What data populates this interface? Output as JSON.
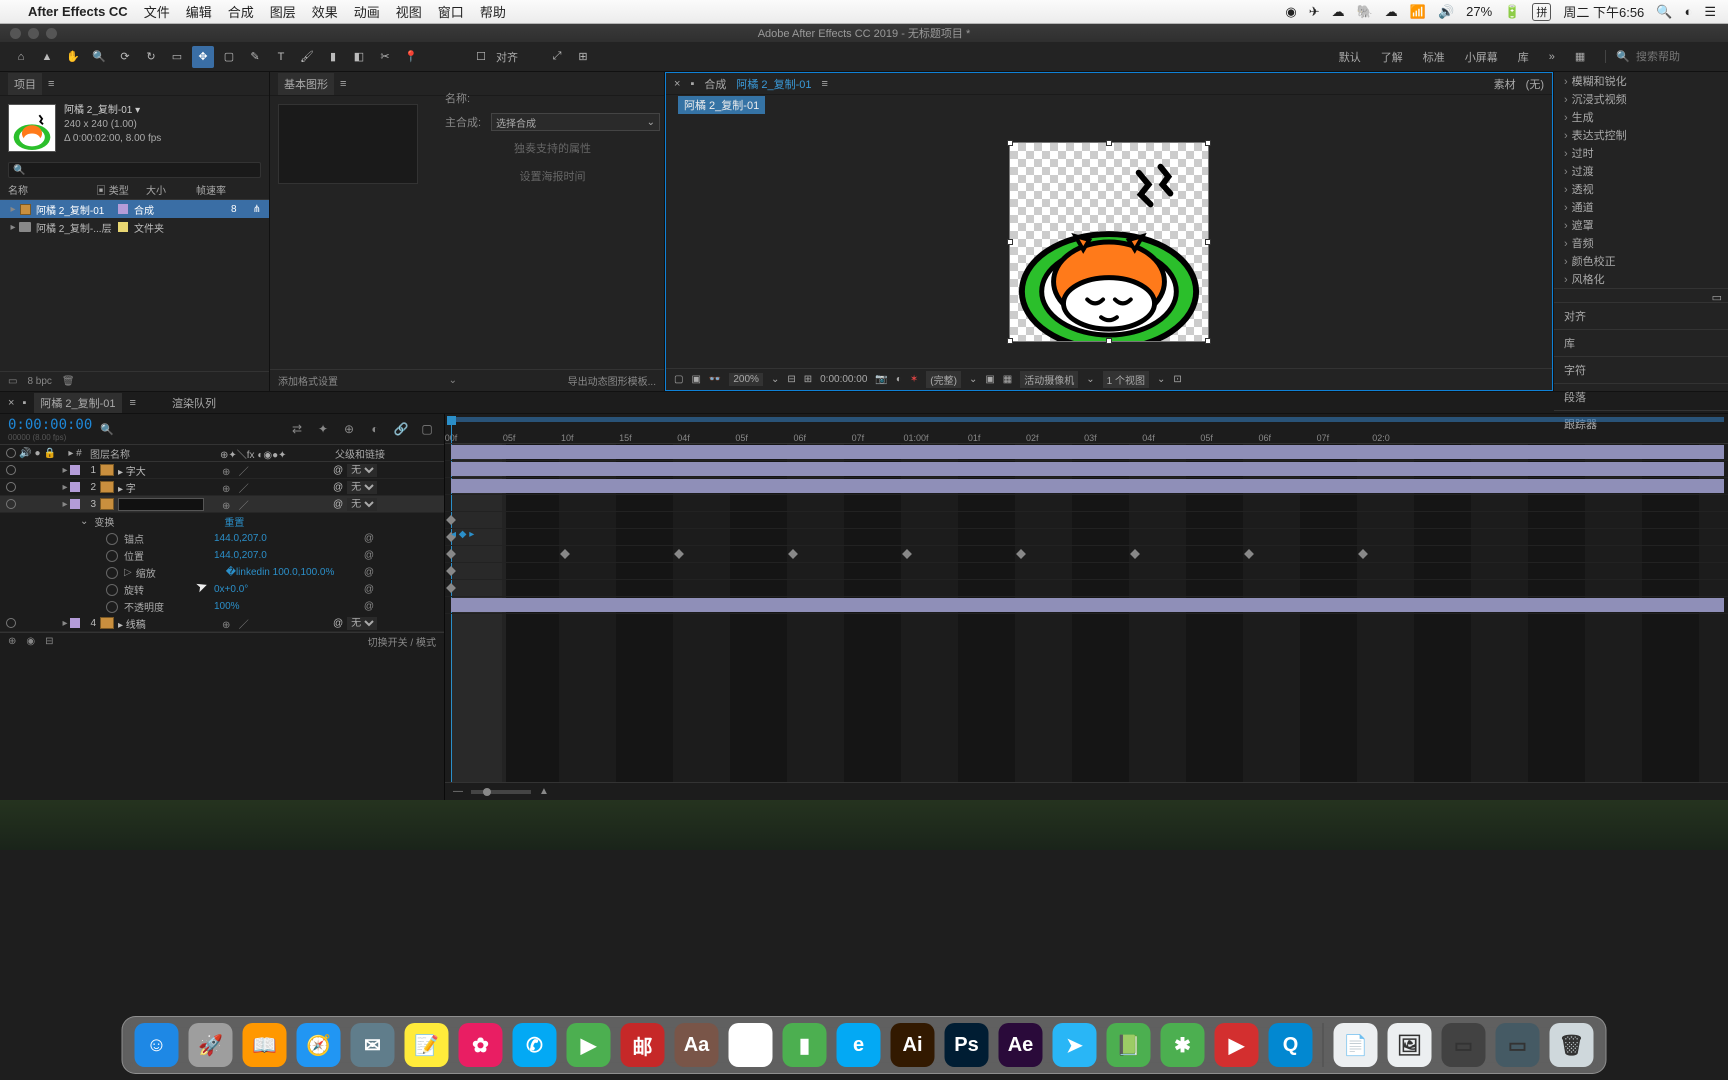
{
  "mac": {
    "app": "After Effects CC",
    "menus": [
      "文件",
      "编辑",
      "合成",
      "图层",
      "效果",
      "动画",
      "视图",
      "窗口",
      "帮助"
    ],
    "battery": "27%",
    "ime": "拼",
    "clock": "周二 下午6:56"
  },
  "window_title": "Adobe After Effects CC 2019 - 无标题项目 *",
  "toolbar": {
    "snap_label": "对齐"
  },
  "workspaces": {
    "items": [
      "默认",
      "了解",
      "标准",
      "小屏幕",
      "库"
    ],
    "more": "»"
  },
  "search": {
    "placeholder": "搜索帮助"
  },
  "project": {
    "tab": "项目",
    "item_name": "阿橘 2_复制-01 ▾",
    "dims": "240 x 240 (1.00)",
    "dur": "Δ 0:00:02:00, 8.00 fps",
    "search_icon": "🔍",
    "cols": [
      "名称",
      "类型",
      "大小",
      "帧速率"
    ],
    "rows": [
      {
        "name": "阿橘 2_复制-01",
        "type": "合成",
        "rate": "8",
        "sel": true,
        "folder": false
      },
      {
        "name": "阿橘 2_复制-...层",
        "type": "文件夹",
        "rate": "",
        "sel": false,
        "folder": true
      }
    ],
    "footer_bpc": "8 bpc"
  },
  "egp": {
    "tab": "基本图形",
    "name_label": "名称:",
    "master_label": "主合成:",
    "master_select": "选择合成",
    "solo": "独奏支持的属性",
    "poster": "设置海报时间",
    "add": "添加格式设置",
    "export": "导出动态图形模板..."
  },
  "viewer": {
    "comp_prefix": "合成",
    "comp_name": "阿橘 2_复制-01",
    "source_label": "素材",
    "source_none": "(无)",
    "sub_tab": "阿橘 2_复制-01",
    "zoom": "200%",
    "time": "0:00:00:00",
    "res": "(完整)",
    "camera": "活动摄像机",
    "views": "1 个视图"
  },
  "fx": {
    "cats": [
      "模糊和锐化",
      "沉浸式视频",
      "生成",
      "表达式控制",
      "过时",
      "过渡",
      "透视",
      "通道",
      "遮罩",
      "音频",
      "颜色校正",
      "风格化"
    ],
    "panels": [
      "对齐",
      "库",
      "字符",
      "段落",
      "跟踪器"
    ]
  },
  "timeline": {
    "tab": "阿橘 2_复制-01",
    "render_tab": "渲染队列",
    "timecode": "0:00:00:00",
    "fps_hint": "00000 (8.00 fps)",
    "cols": {
      "layer_name": "图层名称",
      "parent": "父级和链接",
      "num": "#"
    },
    "ruler": [
      "00f",
      "05f",
      "10f",
      "15f",
      "04f",
      "05f",
      "06f",
      "07f",
      "01:00f",
      "01f",
      "02f",
      "03f",
      "04f",
      "05f",
      "06f",
      "07f",
      "02:0"
    ],
    "layers": [
      {
        "idx": 1,
        "name": "字大",
        "parent": "无"
      },
      {
        "idx": 2,
        "name": "字",
        "parent": "无"
      },
      {
        "idx": 3,
        "name": "",
        "parent": "无",
        "sel": true,
        "editing": true
      },
      {
        "idx": 4,
        "name": "线稿",
        "parent": "无"
      }
    ],
    "transform": {
      "label": "变换",
      "reset": "重置"
    },
    "props": {
      "anchor": {
        "label": "锚点",
        "value": "144.0,207.0"
      },
      "position": {
        "label": "位置",
        "value": "144.0,207.0"
      },
      "scale": {
        "label": "缩放",
        "value": "100.0,100.0%",
        "kf": true
      },
      "rotation": {
        "label": "旋转",
        "value": "0x+0.0°"
      },
      "opacity": {
        "label": "不透明度",
        "value": "100%"
      }
    },
    "footer": "切换开关 / 模式"
  },
  "dock": {
    "apps": [
      {
        "bg": "#1e88e5",
        "txt": "☺"
      },
      {
        "bg": "#9e9e9e",
        "txt": "🚀"
      },
      {
        "bg": "#ff9800",
        "txt": "📖"
      },
      {
        "bg": "#2196f3",
        "txt": "🧭"
      },
      {
        "bg": "#607d8b",
        "txt": "✉"
      },
      {
        "bg": "#ffeb3b",
        "txt": "📝"
      },
      {
        "bg": "#e91e63",
        "txt": "✿"
      },
      {
        "bg": "#03a9f4",
        "txt": "✆"
      },
      {
        "bg": "#4caf50",
        "txt": "▶"
      },
      {
        "bg": "#c62828",
        "txt": "邮"
      },
      {
        "bg": "#795548",
        "txt": "Aa"
      },
      {
        "bg": "#fff",
        "txt": "◯"
      },
      {
        "bg": "#4caf50",
        "txt": "▮"
      },
      {
        "bg": "#03a9f4",
        "txt": "e"
      },
      {
        "bg": "#321900",
        "txt": "Ai"
      },
      {
        "bg": "#001d33",
        "txt": "Ps"
      },
      {
        "bg": "#2a0a3a",
        "txt": "Ae"
      },
      {
        "bg": "#29b6f6",
        "txt": "➤"
      },
      {
        "bg": "#4caf50",
        "txt": "📗"
      },
      {
        "bg": "#4caf50",
        "txt": "✱"
      },
      {
        "bg": "#d32f2f",
        "txt": "▶"
      },
      {
        "bg": "#0288d1",
        "txt": "Q"
      }
    ],
    "right": [
      {
        "bg": "#eceff1",
        "txt": "📄"
      },
      {
        "bg": "#eceff1",
        "txt": "🖼"
      },
      {
        "bg": "#424242",
        "txt": "▭"
      },
      {
        "bg": "#455a64",
        "txt": "▭"
      },
      {
        "bg": "#cfd8dc",
        "txt": "🗑"
      }
    ]
  }
}
